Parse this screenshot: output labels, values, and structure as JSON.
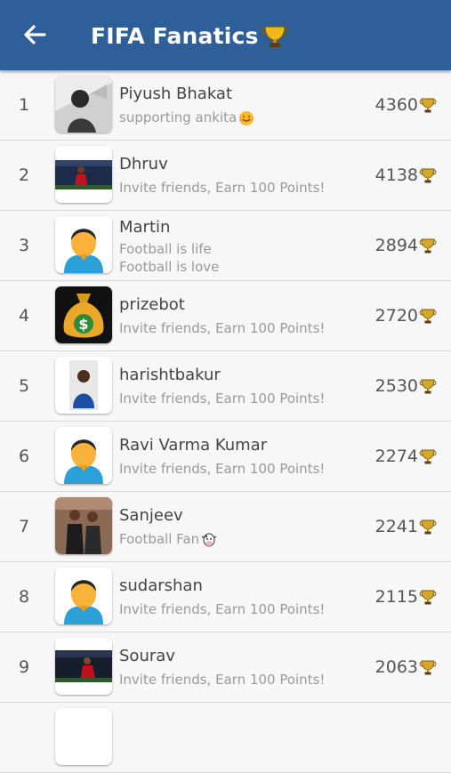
{
  "app_bar": {
    "title": "FIFA Fanatics",
    "bg_color": "#2f5f98",
    "back_icon": "arrow-left-icon",
    "title_icon": "trophy-icon"
  },
  "leaderboard": [
    {
      "rank": "1",
      "name": "Piyush Bhakat",
      "status": "supporting ankita",
      "status_emoji": "smiling-face-icon",
      "score": "4360",
      "avatar": "photo-portrait-bw"
    },
    {
      "rank": "2",
      "name": "Dhruv",
      "status": "Invite friends, Earn 100 Points!",
      "score": "4138",
      "avatar": "photo-football-player-red"
    },
    {
      "rank": "3",
      "name": "Martin",
      "status": "Football is life\nFootball is love",
      "score": "2894",
      "avatar": "default-user-avatar"
    },
    {
      "rank": "4",
      "name": "prizebot",
      "status": "Invite friends, Earn 100 Points!",
      "score": "2720",
      "avatar": "money-bag-avatar"
    },
    {
      "rank": "5",
      "name": "harishtbakur",
      "status": "Invite friends, Earn 100 Points!",
      "score": "2530",
      "avatar": "photo-person-blue-shirt"
    },
    {
      "rank": "6",
      "name": "Ravi Varma Kumar",
      "status": "Invite friends, Earn 100 Points!",
      "score": "2274",
      "avatar": "default-user-avatar"
    },
    {
      "rank": "7",
      "name": "Sanjeev",
      "status": "Football Fan",
      "status_emoji": "cow-face-icon",
      "score": "2241",
      "avatar": "photo-two-men-suits"
    },
    {
      "rank": "8",
      "name": "sudarshan",
      "status": "Invite friends, Earn 100 Points!",
      "score": "2115",
      "avatar": "default-user-avatar"
    },
    {
      "rank": "9",
      "name": "Sourav",
      "status": "Invite friends, Earn 100 Points!",
      "score": "2063",
      "avatar": "photo-football-player-red"
    }
  ]
}
